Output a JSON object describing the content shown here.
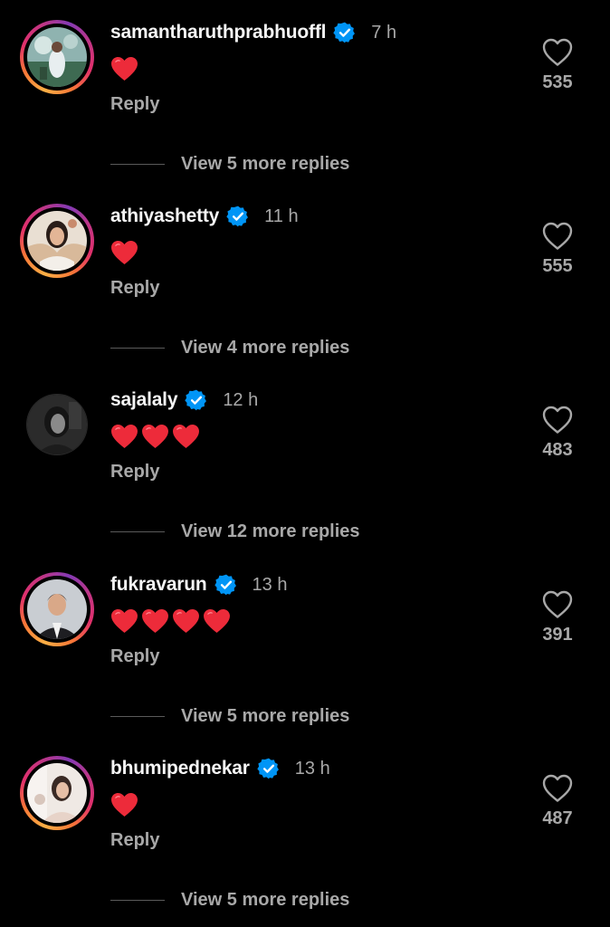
{
  "colors": {
    "background": "#000000",
    "primary_text": "#f5f5f5",
    "secondary_text": "#a8a8a8",
    "verified_blue": "#0095f6",
    "heart_red": "#ed2b3a"
  },
  "comments": [
    {
      "username": "samantharuthprabhuoffl",
      "verified": true,
      "time": "7 h",
      "hearts": 1,
      "reply_label": "Reply",
      "likes": "535",
      "view_replies": "View 5 more replies",
      "story_ring": true
    },
    {
      "username": "athiyashetty",
      "verified": true,
      "time": "11 h",
      "hearts": 1,
      "reply_label": "Reply",
      "likes": "555",
      "view_replies": "View 4 more replies",
      "story_ring": true
    },
    {
      "username": "sajalaly",
      "verified": true,
      "time": "12 h",
      "hearts": 3,
      "reply_label": "Reply",
      "likes": "483",
      "view_replies": "View 12 more replies",
      "story_ring": false
    },
    {
      "username": "fukravarun",
      "verified": true,
      "time": "13 h",
      "hearts": 4,
      "reply_label": "Reply",
      "likes": "391",
      "view_replies": "View 5 more replies",
      "story_ring": true
    },
    {
      "username": "bhumipednekar",
      "verified": true,
      "time": "13 h",
      "hearts": 1,
      "reply_label": "Reply",
      "likes": "487",
      "view_replies": "View 5 more replies",
      "story_ring": true
    }
  ],
  "icons": {
    "like": "heart-outline-icon",
    "verified": "verified-badge-icon",
    "emoji": "red-heart-emoji-icon"
  }
}
